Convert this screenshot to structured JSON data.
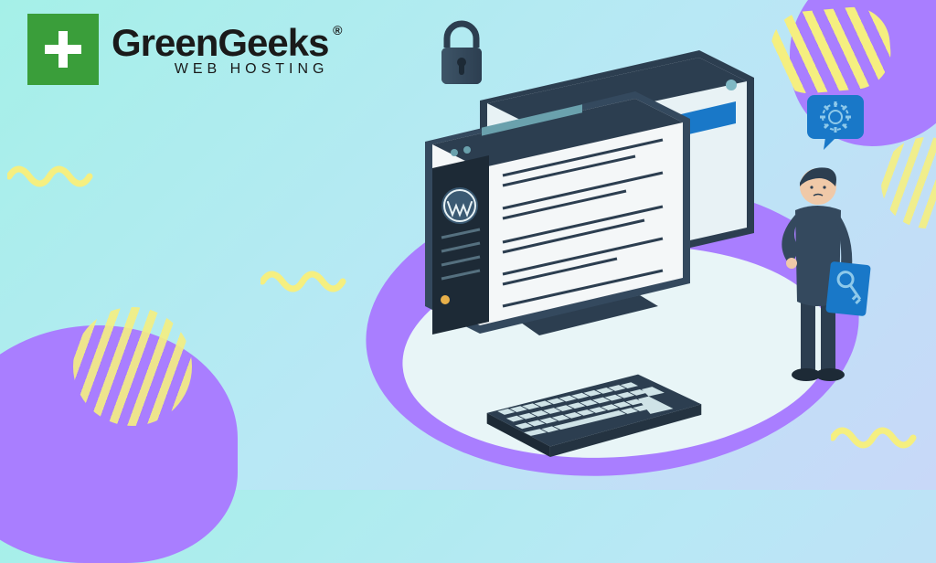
{
  "logo": {
    "brand": "GreenGeeks",
    "registered": "®",
    "tagline": "WEB HOSTING",
    "mark_color": "#3a9e3a"
  },
  "illustration": {
    "padlock": "padlock-icon",
    "gear": "gear-icon",
    "wordpress": "wordpress-icon",
    "key": "key-icon"
  }
}
